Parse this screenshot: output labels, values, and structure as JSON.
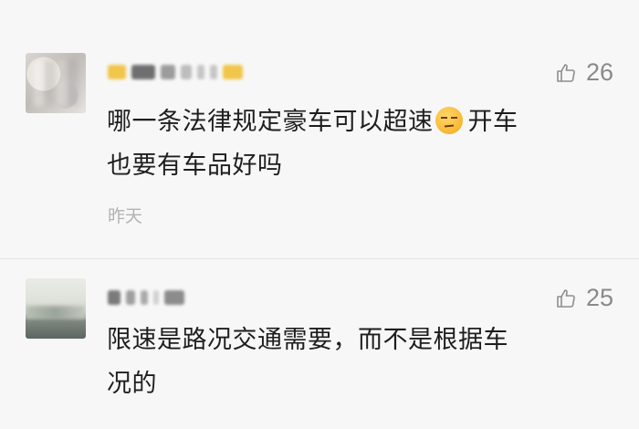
{
  "comments": [
    {
      "text_line1": "哪一条法律规定豪车可以超速",
      "emoji": "unamused-face-emoji",
      "text_line1_tail": "开车",
      "text_line2": "也要有车品好吗",
      "likes": "26",
      "time": "昨天"
    },
    {
      "text_line1": "限速是路况交通需要，而不是根据车",
      "text_line2": "况的",
      "likes": "25"
    }
  ],
  "icons": {
    "like": "thumbs-up-icon"
  },
  "colors": {
    "background": "#f7f7f7",
    "text": "#1e1e1e",
    "meta": "#8a8a8a",
    "time": "#b2b2b2"
  }
}
